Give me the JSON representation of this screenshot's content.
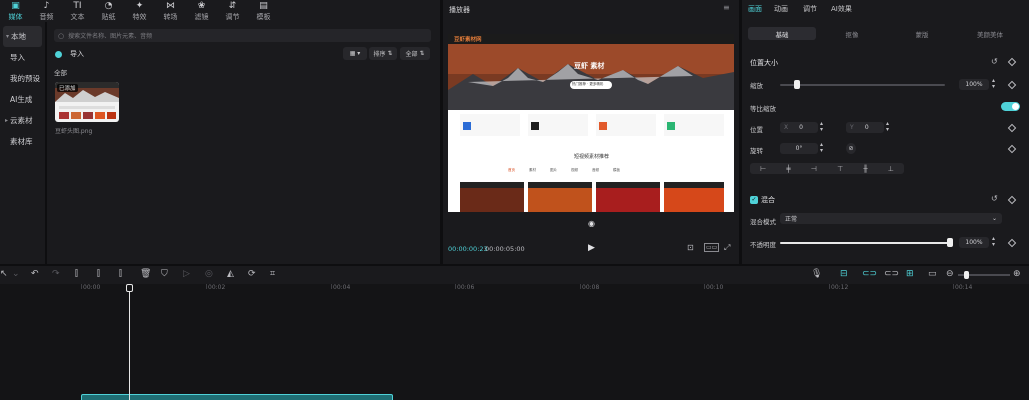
{
  "toolbar": {
    "items": [
      {
        "label": "媒体",
        "icon": "media-icon"
      },
      {
        "label": "音频",
        "icon": "audio-icon"
      },
      {
        "label": "文本",
        "icon": "text-icon"
      },
      {
        "label": "贴纸",
        "icon": "sticker-icon"
      },
      {
        "label": "特效",
        "icon": "effects-icon"
      },
      {
        "label": "转场",
        "icon": "transition-icon"
      },
      {
        "label": "滤镜",
        "icon": "filter-icon"
      },
      {
        "label": "调节",
        "icon": "adjust-icon"
      },
      {
        "label": "模板",
        "icon": "template-icon"
      }
    ]
  },
  "sidebar": {
    "items": [
      {
        "label": "本地",
        "active": true
      },
      {
        "label": "导入"
      },
      {
        "label": "我的预设"
      },
      {
        "label": "AI生成"
      },
      {
        "label": "云素材"
      },
      {
        "label": "素材库"
      }
    ]
  },
  "media": {
    "search_placeholder": "搜索文件名称、图片元素、音频",
    "import_label": "导入",
    "sort_label": "排序",
    "filter_label": "全部",
    "section_label": "全部",
    "file": {
      "badge": "已添加",
      "name": "豆虾头图.png"
    }
  },
  "player": {
    "title": "播放器",
    "current_time": "00:00:00:23",
    "total_time": "00:00:05:00",
    "preview": {
      "site_name": "豆虾素材网",
      "hero_title": "豆虾 素材",
      "hero_button": "热门推荐 · 更多精彩",
      "section_title": "短视频素材推荐",
      "nav": [
        "首页",
        "素材",
        "图片",
        "视频",
        "音频",
        "模板"
      ]
    }
  },
  "properties": {
    "tabs": [
      "画面",
      "动画",
      "调节",
      "AI效果"
    ],
    "sub_tabs": [
      "基础",
      "抠像",
      "蒙版",
      "美颜美体"
    ],
    "position_size_label": "位置大小",
    "scale_label": "缩放",
    "scale_value": "100%",
    "scale_fraction": 0.1,
    "uniform_scale_label": "等比缩放",
    "position_label": "位置",
    "x_label": "X",
    "x_value": "0",
    "y_label": "Y",
    "y_value": "0",
    "rotate_label": "旋转",
    "rotate_value": "0°",
    "blend_label": "混合",
    "blend_mode_label": "混合模式",
    "blend_mode_value": "正常",
    "opacity_label": "不透明度",
    "opacity_value": "100%",
    "opacity_fraction": 1.0
  },
  "timeline": {
    "ticks": [
      "00:00",
      "00:02",
      "00:04",
      "00:06",
      "00:08",
      "00:10",
      "00:12",
      "00:14"
    ]
  },
  "colors": {
    "accent": "#4fd2d8",
    "panel": "#1a1a1d",
    "background": "#0e0e10"
  }
}
